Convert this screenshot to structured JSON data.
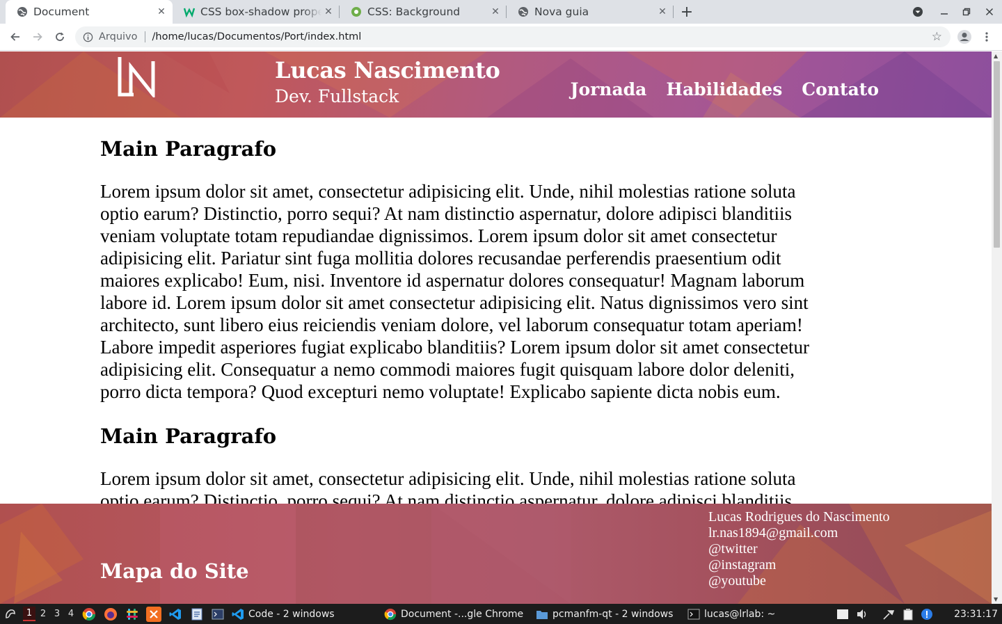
{
  "browser": {
    "tabs": [
      {
        "title": "Document",
        "icon": "globe-icon",
        "active": true
      },
      {
        "title": "CSS box-shadow property",
        "icon": "w3schools-icon",
        "active": false
      },
      {
        "title": "CSS: Background",
        "icon": "mozilla-gear-icon",
        "active": false
      },
      {
        "title": "Nova guia",
        "icon": "globe-icon",
        "active": false
      }
    ],
    "address": {
      "chip": "Arquivo",
      "url": "/home/lucas/Documentos/Port/index.html"
    }
  },
  "site": {
    "logo_text": "LN",
    "name": "Lucas Nascimento",
    "role": "Dev. Fullstack",
    "nav": [
      "Jornada",
      "Habilidades",
      "Contato"
    ],
    "sections": [
      {
        "heading": "Main Paragrafo",
        "body": "Lorem ipsum dolor sit amet, consectetur adipisicing elit. Unde, nihil molestias ratione soluta optio earum? Distinctio, porro sequi? At nam distinctio aspernatur, dolore adipisci blanditiis veniam voluptate totam repudiandae dignissimos. Lorem ipsum dolor sit amet consectetur adipisicing elit. Pariatur sint fuga mollitia dolores recusandae perferendis praesentium odit maiores explicabo! Eum, nisi. Inventore id aspernatur dolores consequatur! Magnam laborum labore id. Lorem ipsum dolor sit amet consectetur adipisicing elit. Natus dignissimos vero sint architecto, sunt libero eius reiciendis veniam dolore, vel laborum consequatur totam aperiam! Labore impedit asperiores fugiat explicabo blanditiis? Lorem ipsum dolor sit amet consectetur adipisicing elit. Consequatur a nemo commodi maiores fugit quisquam labore dolor deleniti, porro dicta tempora? Quod excepturi nemo voluptate! Explicabo sapiente dicta nobis eum."
      },
      {
        "heading": "Main Paragrafo",
        "body": "Lorem ipsum dolor sit amet, consectetur adipisicing elit. Unde, nihil molestias ratione soluta optio earum? Distinctio, porro sequi? At nam distinctio aspernatur, dolore adipisci blanditiis"
      }
    ],
    "footer": {
      "sitemap_title": "Mapa do Site",
      "contact": {
        "name": "Lucas Rodrigues do Nascimento",
        "email": "lr.nas1894@gmail.com",
        "twitter": "@twitter",
        "instagram": "@instagram",
        "youtube": "@youtube"
      }
    }
  },
  "taskbar": {
    "workspaces": [
      "1",
      "2",
      "3",
      "4"
    ],
    "tasks": [
      {
        "label": "Code - 2 windows",
        "icon": "vscode-icon"
      },
      {
        "label": "Document -...gle Chrome",
        "icon": "chrome-icon"
      },
      {
        "label": "pcmanfm-qt - 2 windows",
        "icon": "folder-icon"
      },
      {
        "label": "lucas@lrlab: ~",
        "icon": "terminal-icon"
      }
    ],
    "clock": "23:31:17"
  }
}
